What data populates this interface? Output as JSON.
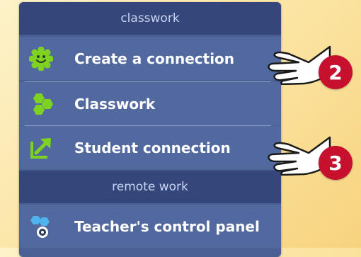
{
  "menu": {
    "sections": [
      {
        "header": "classwork",
        "items": [
          {
            "label": "Create a connection",
            "icon": "smiley-gear-icon"
          },
          {
            "label": "Classwork",
            "icon": "hexagon-cluster-icon"
          },
          {
            "label": "Student connection",
            "icon": "arrow-box-icon"
          }
        ]
      },
      {
        "header": "remote work",
        "items": [
          {
            "label": "Teacher's control panel",
            "icon": "control-panel-icon"
          }
        ]
      }
    ]
  },
  "callouts": [
    {
      "number": "2",
      "icon": "pointing-hand-icon"
    },
    {
      "number": "3",
      "icon": "pointing-hand-icon"
    }
  ],
  "colors": {
    "panel": "#4a5f93",
    "header": "#35477a",
    "item": "#5269a0",
    "icon_green": "#7ed321",
    "icon_blue": "#4fb4ee",
    "badge_red": "#c7102e"
  }
}
